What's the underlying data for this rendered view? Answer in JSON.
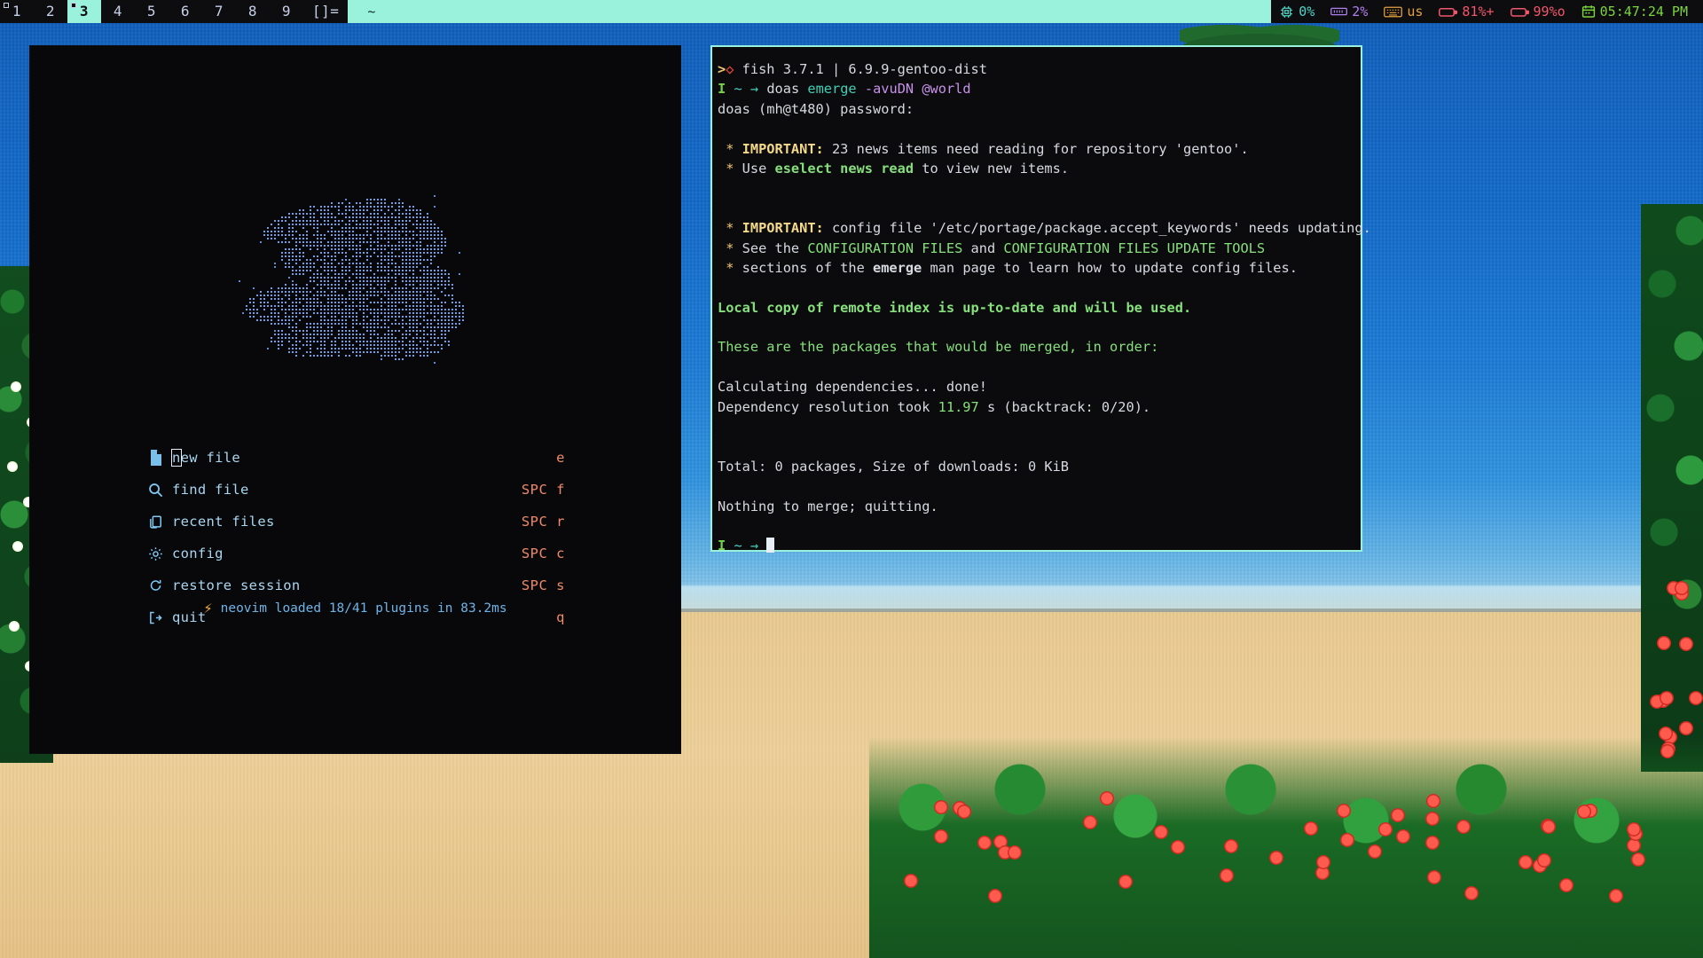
{
  "topbar": {
    "workspaces": [
      {
        "label": "1",
        "active": false,
        "occupied": true
      },
      {
        "label": "2",
        "active": false,
        "occupied": false
      },
      {
        "label": "3",
        "active": true,
        "occupied": true
      },
      {
        "label": "4",
        "active": false,
        "occupied": false
      },
      {
        "label": "5",
        "active": false,
        "occupied": false
      },
      {
        "label": "6",
        "active": false,
        "occupied": false
      },
      {
        "label": "7",
        "active": false,
        "occupied": false
      },
      {
        "label": "8",
        "active": false,
        "occupied": false
      },
      {
        "label": "9",
        "active": false,
        "occupied": false
      },
      {
        "label": "[]=",
        "active": false,
        "occupied": false
      }
    ],
    "window_title": "~",
    "tray": {
      "cpu": {
        "icon": "cpu-chip-icon",
        "value": "0%",
        "color": "#4fd6c8"
      },
      "memory": {
        "icon": "memory-ram-icon",
        "value": "2%",
        "color": "#b07ff0"
      },
      "keyboard": {
        "icon": "keyboard-icon",
        "value": "us",
        "color": "#e2a03f"
      },
      "battery_primary": {
        "icon": "battery-icon",
        "value": "81%+",
        "color": "#f2566a"
      },
      "battery_secondary": {
        "icon": "battery-icon",
        "value": "99%o",
        "color": "#f2566a"
      },
      "clock": {
        "icon": "calendar-icon",
        "value": "05:47:24 PM",
        "color": "#7ad43f"
      }
    }
  },
  "nvim": {
    "menu": [
      {
        "icon": "file-new-icon",
        "label": "new file",
        "key": "e",
        "cursor_index": 0
      },
      {
        "icon": "search-magnifier-icon",
        "label": "find file",
        "key": "SPC f",
        "cursor_index": -1
      },
      {
        "icon": "copy-files-icon",
        "label": "recent files",
        "key": "SPC r",
        "cursor_index": -1
      },
      {
        "icon": "gear-icon",
        "label": "config",
        "key": "SPC c",
        "cursor_index": -1
      },
      {
        "icon": "restore-refresh-icon",
        "label": "restore session",
        "key": "SPC s",
        "cursor_index": -1
      },
      {
        "icon": "exit-arrow-icon",
        "label": "quit",
        "key": "q",
        "cursor_index": -1
      }
    ],
    "footer": {
      "icon": "lightning-bolt-icon",
      "text": "neovim loaded 18/41 plugins in 83.2ms"
    },
    "logo_alt": "dot-matrix ascii art logo"
  },
  "terminal": {
    "lines": [
      [
        {
          "t": ">",
          "c": "c-yellow bold"
        },
        {
          "t": "◇",
          "c": "c-redb bold"
        },
        {
          "t": " fish 3.7.1 | 6.9.9-gentoo-dist",
          "c": "c-fg"
        }
      ],
      [
        {
          "t": "I",
          "c": "c-limegreen bold"
        },
        {
          "t": " ",
          "c": "c-fg"
        },
        {
          "t": "~",
          "c": "c-cyan"
        },
        {
          "t": " ",
          "c": "c-fg"
        },
        {
          "t": "→",
          "c": "c-teal"
        },
        {
          "t": " ",
          "c": "c-fg"
        },
        {
          "t": "doas ",
          "c": "c-fg"
        },
        {
          "t": "emerge",
          "c": "c-teal"
        },
        {
          "t": " ",
          "c": "c-fg"
        },
        {
          "t": "-avuDN",
          "c": "c-magenta"
        },
        {
          "t": " ",
          "c": "c-fg"
        },
        {
          "t": "@world",
          "c": "c-magenta"
        }
      ],
      [
        {
          "t": "doas (mh@t480) password:",
          "c": "c-fg"
        }
      ],
      [
        {
          "t": "",
          "c": "c-fg"
        }
      ],
      [
        {
          "t": " ",
          "c": "c-fg"
        },
        {
          "t": "*",
          "c": "c-yellow"
        },
        {
          "t": " ",
          "c": "c-fg"
        },
        {
          "t": "IMPORTANT:",
          "c": "c-yellowb bold"
        },
        {
          "t": " 23 news items need reading for repository 'gentoo'.",
          "c": "c-fg"
        }
      ],
      [
        {
          "t": " ",
          "c": "c-fg"
        },
        {
          "t": "*",
          "c": "c-yellow"
        },
        {
          "t": " Use ",
          "c": "c-fg"
        },
        {
          "t": "eselect news read",
          "c": "c-green bold"
        },
        {
          "t": " to view new items.",
          "c": "c-fg"
        }
      ],
      [
        {
          "t": "",
          "c": "c-fg"
        }
      ],
      [
        {
          "t": "",
          "c": "c-fg"
        }
      ],
      [
        {
          "t": " ",
          "c": "c-fg"
        },
        {
          "t": "*",
          "c": "c-yellow"
        },
        {
          "t": " ",
          "c": "c-fg"
        },
        {
          "t": "IMPORTANT:",
          "c": "c-yellowb bold"
        },
        {
          "t": " config file '/etc/portage/package.accept_keywords' needs updating.",
          "c": "c-fg"
        }
      ],
      [
        {
          "t": " ",
          "c": "c-fg"
        },
        {
          "t": "*",
          "c": "c-yellow"
        },
        {
          "t": " See the ",
          "c": "c-fg"
        },
        {
          "t": "CONFIGURATION FILES",
          "c": "c-green"
        },
        {
          "t": " and ",
          "c": "c-fg"
        },
        {
          "t": "CONFIGURATION FILES UPDATE TOOLS",
          "c": "c-green"
        }
      ],
      [
        {
          "t": " ",
          "c": "c-fg"
        },
        {
          "t": "*",
          "c": "c-yellow"
        },
        {
          "t": " sections of the ",
          "c": "c-fg"
        },
        {
          "t": "emerge",
          "c": "c-fg bold"
        },
        {
          "t": " man page to learn how to update config files.",
          "c": "c-fg"
        }
      ],
      [
        {
          "t": "",
          "c": "c-fg"
        }
      ],
      [
        {
          "t": "Local copy of remote index is up-to-date and will be used.",
          "c": "c-green bold"
        }
      ],
      [
        {
          "t": "",
          "c": "c-fg"
        }
      ],
      [
        {
          "t": "These are the packages that would be merged, in order:",
          "c": "c-green"
        }
      ],
      [
        {
          "t": "",
          "c": "c-fg"
        }
      ],
      [
        {
          "t": "Calculating dependencies... done!",
          "c": "c-fg"
        }
      ],
      [
        {
          "t": "Dependency resolution took ",
          "c": "c-fg"
        },
        {
          "t": "11.97",
          "c": "c-green"
        },
        {
          "t": " s (backtrack: 0/20).",
          "c": "c-fg"
        }
      ],
      [
        {
          "t": "",
          "c": "c-fg"
        }
      ],
      [
        {
          "t": "",
          "c": "c-fg"
        }
      ],
      [
        {
          "t": "Total: 0 packages, Size of downloads: 0 KiB",
          "c": "c-fg"
        }
      ],
      [
        {
          "t": "",
          "c": "c-fg"
        }
      ],
      [
        {
          "t": "Nothing to merge; quitting.",
          "c": "c-fg"
        }
      ],
      [
        {
          "t": "",
          "c": "c-fg"
        }
      ],
      [
        {
          "t": "I",
          "c": "c-limegreen bold"
        },
        {
          "t": " ",
          "c": "c-fg"
        },
        {
          "t": "~",
          "c": "c-cyan"
        },
        {
          "t": " ",
          "c": "c-fg"
        },
        {
          "t": "→",
          "c": "c-teal"
        },
        {
          "t": " ",
          "c": "c-fg"
        },
        {
          "t": "__CURSOR__",
          "c": "cursor"
        }
      ]
    ]
  }
}
